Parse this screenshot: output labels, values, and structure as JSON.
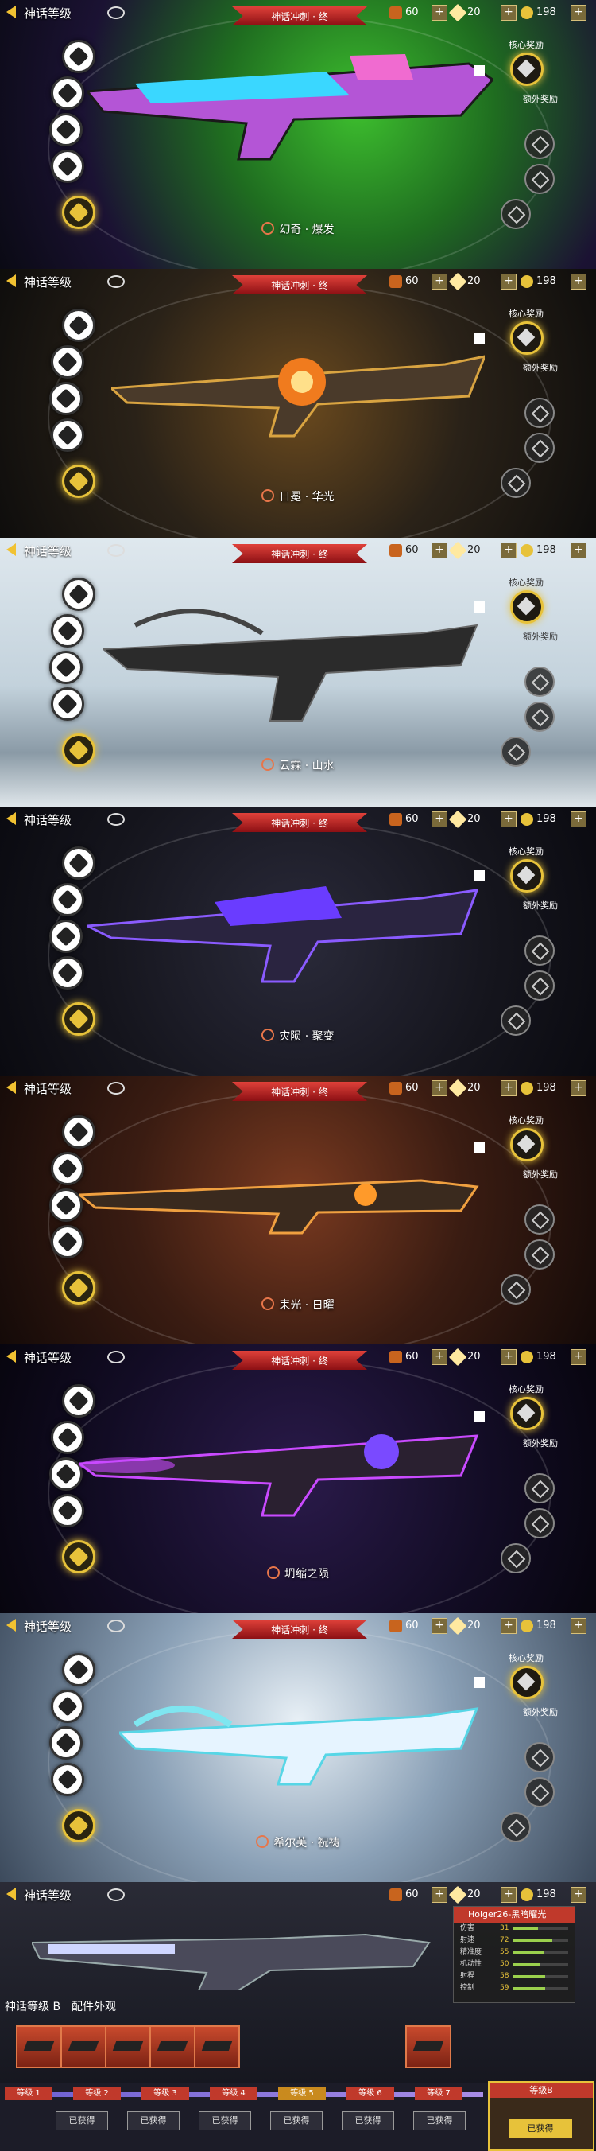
{
  "header": {
    "level_label": "神话等级",
    "banner": "神话冲刺 · 终",
    "tickets": "60",
    "gems": "20",
    "coins": "198"
  },
  "reward_panel": {
    "core_label": "核心奖励",
    "extra_label": "额外奖励"
  },
  "skins": [
    {
      "name": "幻奇 · 爆发"
    },
    {
      "name": "日冕 · 华光"
    },
    {
      "name": "云霖 · 山水"
    },
    {
      "name": "灾陨 · 聚变"
    },
    {
      "name": "耒光 · 日曜"
    },
    {
      "name": "坍缩之陨"
    },
    {
      "name": "希尔芙 · 祝祷"
    }
  ],
  "last_screen": {
    "weapon_title": "Holger26-黑暗曜光",
    "stats": [
      {
        "label": "伤害",
        "value": "31",
        "pct": 0.45
      },
      {
        "label": "射速",
        "value": "72",
        "pct": 0.72
      },
      {
        "label": "精准度",
        "value": "55",
        "pct": 0.55
      },
      {
        "label": "机动性",
        "value": "50",
        "pct": 0.5
      },
      {
        "label": "射程",
        "value": "58",
        "pct": 0.58
      },
      {
        "label": "控制",
        "value": "59",
        "pct": 0.59
      }
    ],
    "tab_level": "神话等级 B",
    "tab_parts": "配件外观",
    "steps": [
      "等级 1",
      "等级 2",
      "等级 3",
      "等级 4",
      "等级 5",
      "等级 6",
      "等级 7"
    ],
    "status": "已获得",
    "final_label": "等级B",
    "final_status": "已获得"
  }
}
